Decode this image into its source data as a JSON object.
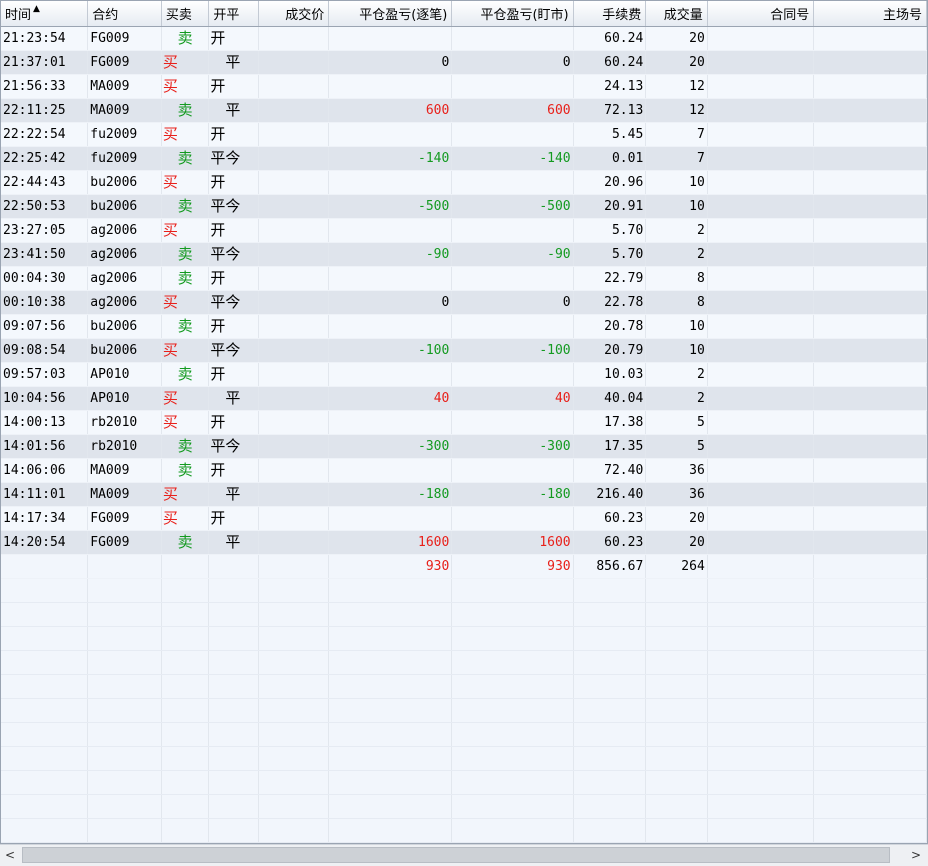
{
  "columns": [
    "时间",
    "合约",
    "买卖",
    "开平",
    "成交价",
    "平仓盈亏(逐笔)",
    "平仓盈亏(盯市)",
    "手续费",
    "成交量",
    "合同号",
    "主场号"
  ],
  "sort_indicator": "▲",
  "rows": [
    {
      "time": "21:23:54",
      "contract": "FG009",
      "side": "卖",
      "oc": "开",
      "price": "",
      "pnl_trade": "",
      "pnl_mark": "",
      "fee": "60.24",
      "vol": "20"
    },
    {
      "time": "21:37:01",
      "contract": "FG009",
      "side": "买",
      "oc": "平",
      "price": "",
      "pnl_trade": "0",
      "pnl_mark": "0",
      "fee": "60.24",
      "vol": "20"
    },
    {
      "time": "21:56:33",
      "contract": "MA009",
      "side": "买",
      "oc": "开",
      "price": "",
      "pnl_trade": "",
      "pnl_mark": "",
      "fee": "24.13",
      "vol": "12"
    },
    {
      "time": "22:11:25",
      "contract": "MA009",
      "side": "卖",
      "oc": "平",
      "price": "",
      "pnl_trade": "600",
      "pnl_mark": "600",
      "fee": "72.13",
      "vol": "12"
    },
    {
      "time": "22:22:54",
      "contract": "fu2009",
      "side": "买",
      "oc": "开",
      "price": "",
      "pnl_trade": "",
      "pnl_mark": "",
      "fee": "5.45",
      "vol": "7"
    },
    {
      "time": "22:25:42",
      "contract": "fu2009",
      "side": "卖",
      "oc": "平今",
      "price": "",
      "pnl_trade": "-140",
      "pnl_mark": "-140",
      "fee": "0.01",
      "vol": "7"
    },
    {
      "time": "22:44:43",
      "contract": "bu2006",
      "side": "买",
      "oc": "开",
      "price": "",
      "pnl_trade": "",
      "pnl_mark": "",
      "fee": "20.96",
      "vol": "10"
    },
    {
      "time": "22:50:53",
      "contract": "bu2006",
      "side": "卖",
      "oc": "平今",
      "price": "",
      "pnl_trade": "-500",
      "pnl_mark": "-500",
      "fee": "20.91",
      "vol": "10"
    },
    {
      "time": "23:27:05",
      "contract": "ag2006",
      "side": "买",
      "oc": "开",
      "price": "",
      "pnl_trade": "",
      "pnl_mark": "",
      "fee": "5.70",
      "vol": "2"
    },
    {
      "time": "23:41:50",
      "contract": "ag2006",
      "side": "卖",
      "oc": "平今",
      "price": "",
      "pnl_trade": "-90",
      "pnl_mark": "-90",
      "fee": "5.70",
      "vol": "2"
    },
    {
      "time": "00:04:30",
      "contract": "ag2006",
      "side": "卖",
      "oc": "开",
      "price": "",
      "pnl_trade": "",
      "pnl_mark": "",
      "fee": "22.79",
      "vol": "8"
    },
    {
      "time": "00:10:38",
      "contract": "ag2006",
      "side": "买",
      "oc": "平今",
      "price": "",
      "pnl_trade": "0",
      "pnl_mark": "0",
      "fee": "22.78",
      "vol": "8"
    },
    {
      "time": "09:07:56",
      "contract": "bu2006",
      "side": "卖",
      "oc": "开",
      "price": "",
      "pnl_trade": "",
      "pnl_mark": "",
      "fee": "20.78",
      "vol": "10"
    },
    {
      "time": "09:08:54",
      "contract": "bu2006",
      "side": "买",
      "oc": "平今",
      "price": "",
      "pnl_trade": "-100",
      "pnl_mark": "-100",
      "fee": "20.79",
      "vol": "10"
    },
    {
      "time": "09:57:03",
      "contract": "AP010",
      "side": "卖",
      "oc": "开",
      "price": "",
      "pnl_trade": "",
      "pnl_mark": "",
      "fee": "10.03",
      "vol": "2"
    },
    {
      "time": "10:04:56",
      "contract": "AP010",
      "side": "买",
      "oc": "平",
      "price": "",
      "pnl_trade": "40",
      "pnl_mark": "40",
      "fee": "40.04",
      "vol": "2"
    },
    {
      "time": "14:00:13",
      "contract": "rb2010",
      "side": "买",
      "oc": "开",
      "price": "",
      "pnl_trade": "",
      "pnl_mark": "",
      "fee": "17.38",
      "vol": "5"
    },
    {
      "time": "14:01:56",
      "contract": "rb2010",
      "side": "卖",
      "oc": "平今",
      "price": "",
      "pnl_trade": "-300",
      "pnl_mark": "-300",
      "fee": "17.35",
      "vol": "5"
    },
    {
      "time": "14:06:06",
      "contract": "MA009",
      "side": "卖",
      "oc": "开",
      "price": "",
      "pnl_trade": "",
      "pnl_mark": "",
      "fee": "72.40",
      "vol": "36"
    },
    {
      "time": "14:11:01",
      "contract": "MA009",
      "side": "买",
      "oc": "平",
      "price": "",
      "pnl_trade": "-180",
      "pnl_mark": "-180",
      "fee": "216.40",
      "vol": "36"
    },
    {
      "time": "14:17:34",
      "contract": "FG009",
      "side": "买",
      "oc": "开",
      "price": "",
      "pnl_trade": "",
      "pnl_mark": "",
      "fee": "60.23",
      "vol": "20"
    },
    {
      "time": "14:20:54",
      "contract": "FG009",
      "side": "卖",
      "oc": "平",
      "price": "",
      "pnl_trade": "1600",
      "pnl_mark": "1600",
      "fee": "60.23",
      "vol": "20"
    }
  ],
  "totals": {
    "pnl_trade": "930",
    "pnl_mark": "930",
    "fee": "856.67",
    "vol": "264"
  },
  "colors": {
    "buy": "#e8201a",
    "sell": "#139a20",
    "profit": "#e8201a",
    "loss": "#139a20"
  },
  "scrollbar": {
    "left_arrow": "<",
    "right_arrow": ">"
  }
}
